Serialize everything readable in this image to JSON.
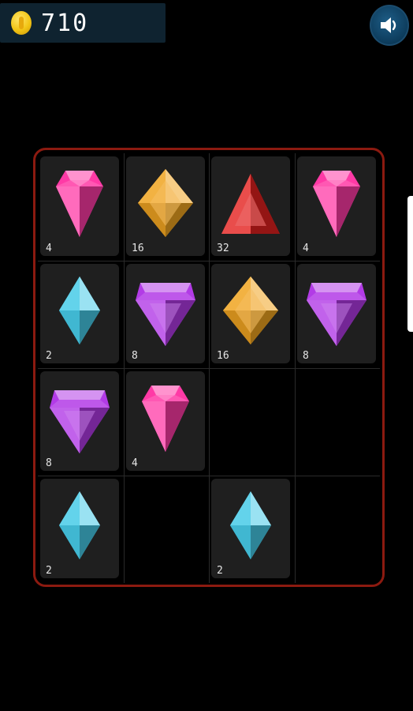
{
  "hud": {
    "coins": "710",
    "coin_icon": "coin-icon",
    "sound_icon": "speaker-icon"
  },
  "board": {
    "rows": 4,
    "cols": 4,
    "cells": [
      [
        {
          "gem": "pink",
          "value": "4"
        },
        {
          "gem": "orange",
          "value": "16"
        },
        {
          "gem": "red",
          "value": "32"
        },
        {
          "gem": "pink",
          "value": "4"
        }
      ],
      [
        {
          "gem": "cyan",
          "value": "2"
        },
        {
          "gem": "purple",
          "value": "8"
        },
        {
          "gem": "orange",
          "value": "16"
        },
        {
          "gem": "purple",
          "value": "8"
        }
      ],
      [
        {
          "gem": "purple",
          "value": "8"
        },
        {
          "gem": "pink",
          "value": "4"
        },
        null,
        null
      ],
      [
        {
          "gem": "cyan",
          "value": "2"
        },
        null,
        {
          "gem": "cyan",
          "value": "2"
        },
        null
      ]
    ]
  },
  "colors": {
    "pink": "#ff3aa6",
    "orange": "#f0a421",
    "red": "#e3201e",
    "cyan": "#47cbe8",
    "purple": "#b23be6",
    "board_border": "#8c1a10"
  }
}
